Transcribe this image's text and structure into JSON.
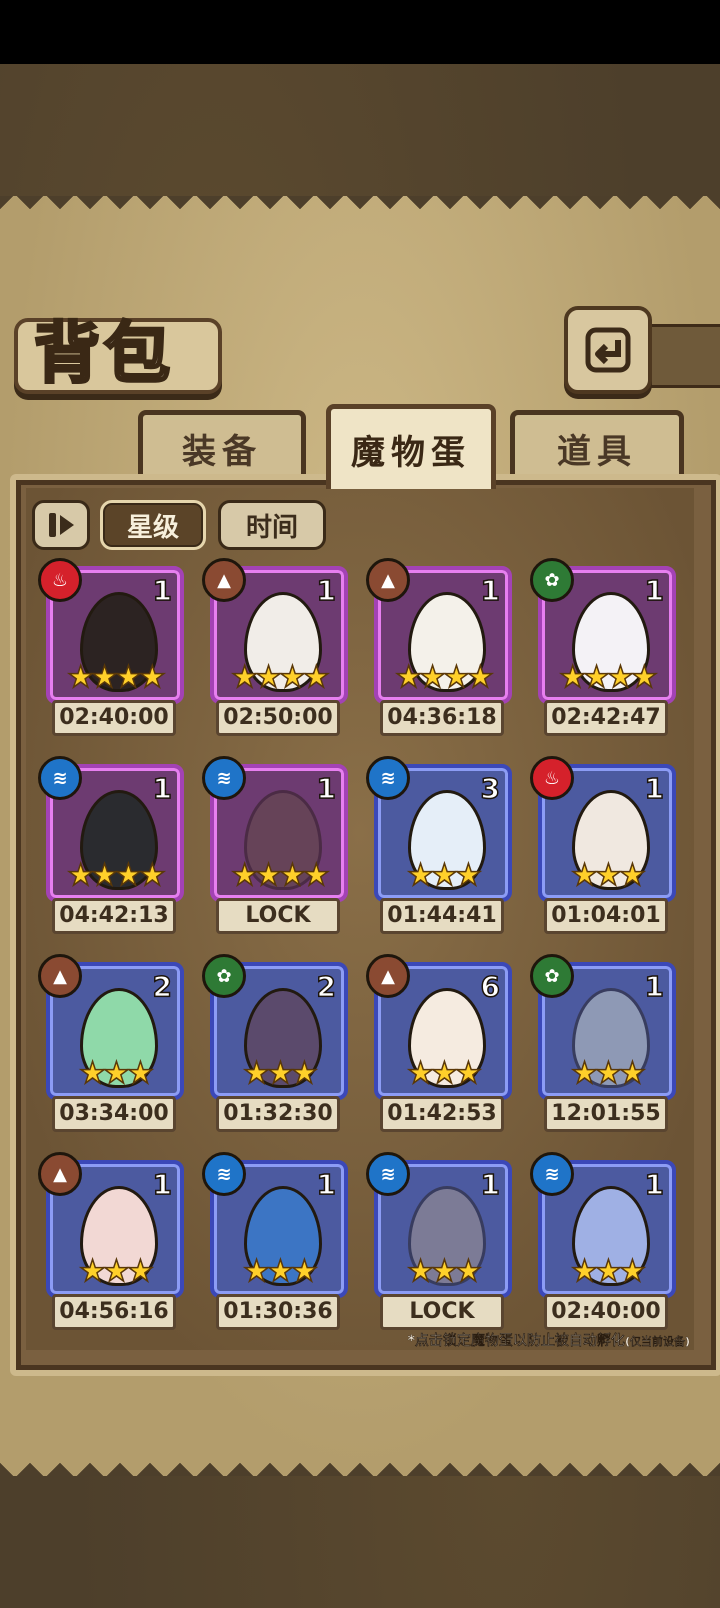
{
  "header": {
    "title": "背包"
  },
  "tabs": [
    {
      "label": "装备",
      "active": false
    },
    {
      "label": "魔物蛋",
      "active": true
    },
    {
      "label": "道具",
      "active": false
    }
  ],
  "sort": {
    "star_label": "星级",
    "time_label": "时间",
    "active": "星级"
  },
  "eggs": [
    {
      "element": "fire-icon",
      "count": "1",
      "stars": "★★★★",
      "rarity": "purple",
      "timer": "02:40:00",
      "egg_color": "#2c2322"
    },
    {
      "element": "earth-icon",
      "count": "1",
      "stars": "★★★★",
      "rarity": "purple",
      "timer": "02:50:00",
      "egg_color": "#f1ede8"
    },
    {
      "element": "earth-icon",
      "count": "1",
      "stars": "★★★★",
      "rarity": "purple",
      "timer": "04:36:18",
      "egg_color": "#f4f1ea"
    },
    {
      "element": "nature-icon",
      "count": "1",
      "stars": "★★★★",
      "rarity": "purple",
      "timer": "02:42:47",
      "egg_color": "#f4f2f6"
    },
    {
      "element": "water-icon",
      "count": "1",
      "stars": "★★★★",
      "rarity": "purple",
      "timer": "04:42:13",
      "egg_color": "#2a2b2f"
    },
    {
      "element": "water-icon",
      "count": "1",
      "stars": "★★★★",
      "rarity": "purple",
      "timer": "LOCK",
      "egg_color": "#5e4f3a",
      "locked": true
    },
    {
      "element": "water-icon",
      "count": "3",
      "stars": "★★★",
      "rarity": "blue",
      "timer": "01:44:41",
      "egg_color": "#e5eef8"
    },
    {
      "element": "fire-icon",
      "count": "1",
      "stars": "★★★",
      "rarity": "blue",
      "timer": "01:04:01",
      "egg_color": "#f0e8e0"
    },
    {
      "element": "earth-icon",
      "count": "2",
      "stars": "★★★",
      "rarity": "blue",
      "timer": "03:34:00",
      "egg_color": "#8fd9a9"
    },
    {
      "element": "nature-icon",
      "count": "2",
      "stars": "★★★",
      "rarity": "blue",
      "timer": "01:32:30",
      "egg_color": "#5b4a6c"
    },
    {
      "element": "earth-icon",
      "count": "6",
      "stars": "★★★",
      "rarity": "blue",
      "timer": "01:42:53",
      "egg_color": "#f5ebe0"
    },
    {
      "element": "nature-icon",
      "count": "1",
      "stars": "★★★",
      "rarity": "blue",
      "timer": "12:01:55",
      "egg_color": "#dfe6cf",
      "locked": true
    },
    {
      "element": "earth-icon",
      "count": "1",
      "stars": "★★★",
      "rarity": "blue",
      "timer": "04:56:16",
      "egg_color": "#f2d8d4"
    },
    {
      "element": "water-icon",
      "count": "1",
      "stars": "★★★",
      "rarity": "blue",
      "timer": "01:30:36",
      "egg_color": "#3c75c4"
    },
    {
      "element": "water-icon",
      "count": "1",
      "stars": "★★★",
      "rarity": "blue",
      "timer": "LOCK",
      "egg_color": "#b9a58b",
      "locked": true
    },
    {
      "element": "water-icon",
      "count": "1",
      "stars": "★★★",
      "rarity": "blue",
      "timer": "02:40:00",
      "egg_color": "#9fb0e4"
    }
  ],
  "footer_note": {
    "main": "*点击锁定魔物蛋以防止被自动孵化",
    "sub": "(仅当前设备)"
  }
}
